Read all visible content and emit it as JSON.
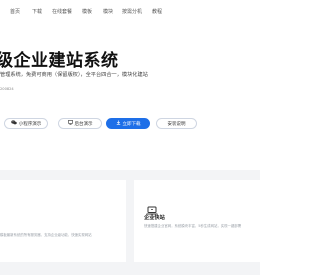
{
  "nav": {
    "items": [
      {
        "label": "首页"
      },
      {
        "label": "下载"
      },
      {
        "label": "在线套餐"
      },
      {
        "label": "模板"
      },
      {
        "label": "模块"
      },
      {
        "label": "按需分机"
      },
      {
        "label": "教程"
      }
    ]
  },
  "hero": {
    "title": "级企业建站系统",
    "subtitle": "管理系统，免费可商用（保留版权），全平台四合一，模块化建站",
    "version": "200824"
  },
  "buttons": [
    {
      "label": "小程序演示",
      "icon": "wechat-icon"
    },
    {
      "label": "后台演示",
      "icon": "monitor-icon"
    },
    {
      "label": "立即下载",
      "icon": "download-icon"
    },
    {
      "label": "安装说明",
      "icon": ""
    }
  ],
  "features": [
    {
      "title": "",
      "desc": "模板最新系统的所有服务器，支持企业级功能，快速实现网站"
    },
    {
      "title": "企业快站",
      "desc": "快速搭建企业官网，系统模块丰富，5秒生成网站，实现一键部署"
    }
  ],
  "colors": {
    "primary": "#1e6fe8",
    "section_bg": "#f3f4f6"
  }
}
